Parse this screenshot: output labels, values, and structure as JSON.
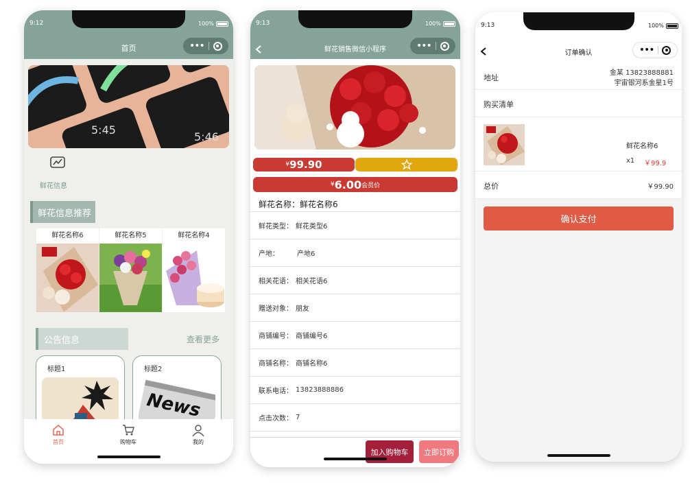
{
  "home": {
    "status_time": "9:12",
    "battery": "100%",
    "title": "首页",
    "banner_times": [
      "5:45",
      "5:46"
    ],
    "info_tile_label": "鲜花信息",
    "recommend_title": "鲜花信息推荐",
    "recommend_items": [
      {
        "name": "鲜花名称6"
      },
      {
        "name": "鲜花名称5"
      },
      {
        "name": "鲜花名称4"
      }
    ],
    "notice_title": "公告信息",
    "more_label": "查看更多",
    "notices": [
      {
        "title": "标题1"
      },
      {
        "title": "标题2",
        "image_text": "News"
      }
    ],
    "tabs": [
      {
        "label": "首页",
        "icon": "home-icon"
      },
      {
        "label": "购物车",
        "icon": "cart-icon"
      },
      {
        "label": "我的",
        "icon": "user-icon"
      }
    ],
    "accent": "#86a39a"
  },
  "detail": {
    "status_time": "9:13",
    "battery": "100%",
    "title": "鲜花销售微信小程序",
    "price_symbol": "¥",
    "price": "99.90",
    "member_price": "6.00",
    "member_label": "会员价",
    "name_line": "鲜花名称：鲜花名称6",
    "rows": [
      {
        "label": "鲜花类型：",
        "value": "鲜花类型6"
      },
      {
        "label": "产地：",
        "value": "产地6"
      },
      {
        "label": "相关花语：",
        "value": "相关花语6"
      },
      {
        "label": "赠送对象：",
        "value": "朋友"
      },
      {
        "label": "商铺编号：",
        "value": "商铺编号6"
      },
      {
        "label": "商铺名称：",
        "value": "商铺名称6"
      },
      {
        "label": "联系电话：",
        "value": "13823888886"
      },
      {
        "label": "点击次数：",
        "value": "7"
      }
    ],
    "add_cart": "加入购物车",
    "buy_now": "立即订购"
  },
  "order": {
    "status_time": "9:13",
    "battery": "100%",
    "title": "订单确认",
    "address_label": "地址",
    "address_line1": "金某 13823888881",
    "address_line2": "宇宙银河系金星1号",
    "list_label": "购买清单",
    "item_name": "鲜花名称6",
    "item_qty": "x1",
    "item_price": "￥99.9",
    "total_label": "总价",
    "total_value": "￥99.90",
    "pay_button": "确认支付"
  }
}
